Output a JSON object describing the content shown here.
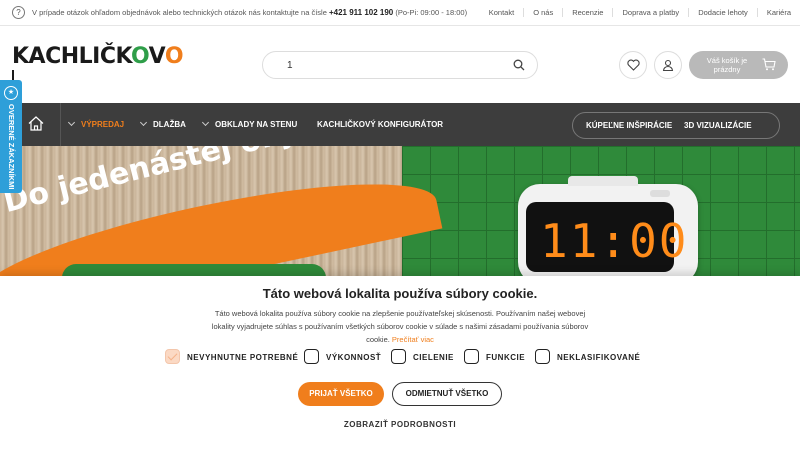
{
  "topbar": {
    "help_icon": "?",
    "message": "V prípade otázok ohľadom objednávok alebo technických otázok nás kontaktujte na čísle",
    "phone": "+421 911 102 190",
    "hours": "(Po-Pi: 09:00 - 18:00)",
    "links": [
      "Kontakt",
      "O nás",
      "Recenzie",
      "Doprava a platby",
      "Dodacie lehoty",
      "Kariéra"
    ]
  },
  "header": {
    "logo": {
      "part1": "KACHLIČK",
      "o1": "O",
      "v": "V",
      "o2": "O"
    },
    "search_value": "1",
    "icons": {
      "search": "search-icon",
      "wishlist": "heart-icon",
      "account": "user-icon",
      "cart": "cart-icon"
    },
    "cart_label": "Váš košík je prázdny"
  },
  "sidetab": {
    "label": "OVERENÉ ZÁKAZNÍKMI"
  },
  "nav": {
    "home_icon": "home-icon",
    "items": [
      "VÝPREDAJ",
      "DLAŽBA",
      "OBKLADY NA STENU",
      "KACHLIČKOVÝ KONFIGURÁTOR"
    ],
    "pill_items": [
      "KÚPEĽNE INŠPIRÁCIE",
      "3D VIZUALIZÁCIE"
    ]
  },
  "hero": {
    "headline": "Do jedenástej objednáte",
    "clock": "11:00"
  },
  "cookie": {
    "title": "Táto webová lokalita používa súbory cookie.",
    "description": "Táto webová lokalita používa súbory cookie na zlepšenie používateľskej skúsenosti. Používaním našej webovej lokality vyjadrujete súhlas s používaním všetkých súborov cookie v súlade s našimi zásadami používania súborov cookie.",
    "read_more": "Prečítať viac",
    "checkboxes": [
      {
        "label": "NEVYHNUTNE POTREBNÉ",
        "checked": true
      },
      {
        "label": "VÝKONNOSŤ",
        "checked": false
      },
      {
        "label": "CIELENIE",
        "checked": false
      },
      {
        "label": "FUNKCIE",
        "checked": false
      },
      {
        "label": "NEKLASIFIKOVANÉ",
        "checked": false
      }
    ],
    "accept_label": "PRIJAŤ VŠETKO",
    "reject_label": "ODMIETNUŤ VŠETKO",
    "details_label": "ZOBRAZIŤ PODROBNOSTI"
  },
  "colors": {
    "accent": "#f07e1c",
    "green": "#2f8a3a",
    "nav_bg": "#3d3d3d",
    "side_tab": "#2e9fd9"
  }
}
